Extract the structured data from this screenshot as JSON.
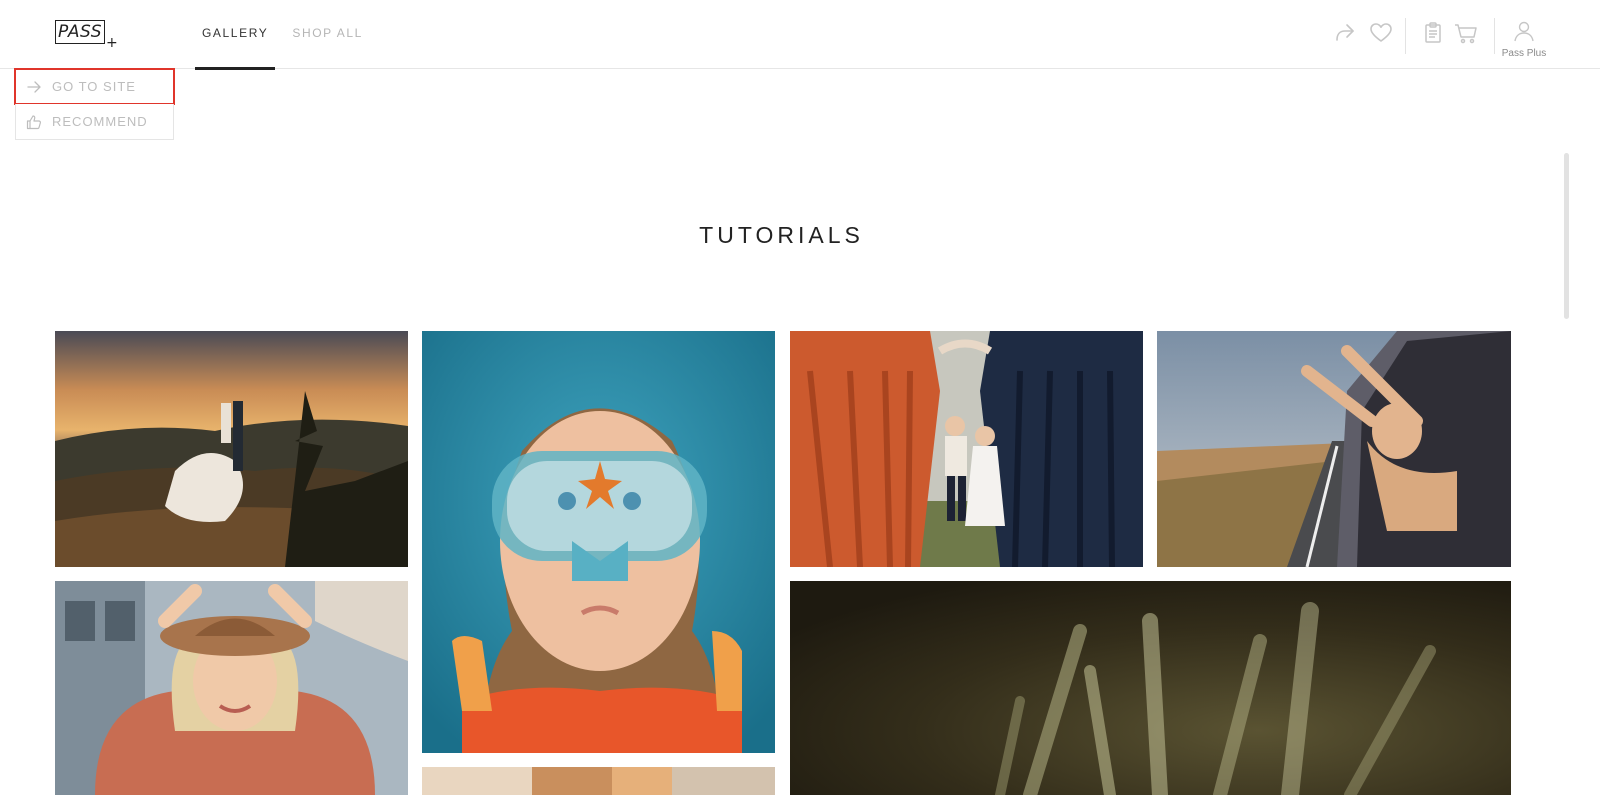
{
  "header": {
    "logo_text": "PASS",
    "logo_plus": "+",
    "tabs": [
      {
        "label": "GALLERY",
        "active": true
      },
      {
        "label": "SHOP ALL",
        "active": false
      }
    ],
    "icons": [
      "share-icon",
      "heart-icon",
      "clipboard-icon",
      "cart-icon",
      "user-icon"
    ],
    "account_label": "Pass Plus"
  },
  "actions": {
    "go_to_site": "GO TO SITE",
    "recommend": "RECOMMEND"
  },
  "section": {
    "title": "TUTORIALS"
  },
  "gallery": [
    {
      "name": "couple-sunset-photo"
    },
    {
      "name": "girl-snorkel-mask-photo"
    },
    {
      "name": "wedding-party-kids-photo"
    },
    {
      "name": "boy-car-window-photo"
    },
    {
      "name": "girl-hat-photo"
    },
    {
      "name": "grass-closeup-photo"
    },
    {
      "name": "partial-bottom-photo"
    }
  ],
  "colors": {
    "accent_border": "#e0352b",
    "muted": "#bdbdbd",
    "text": "#222222"
  }
}
